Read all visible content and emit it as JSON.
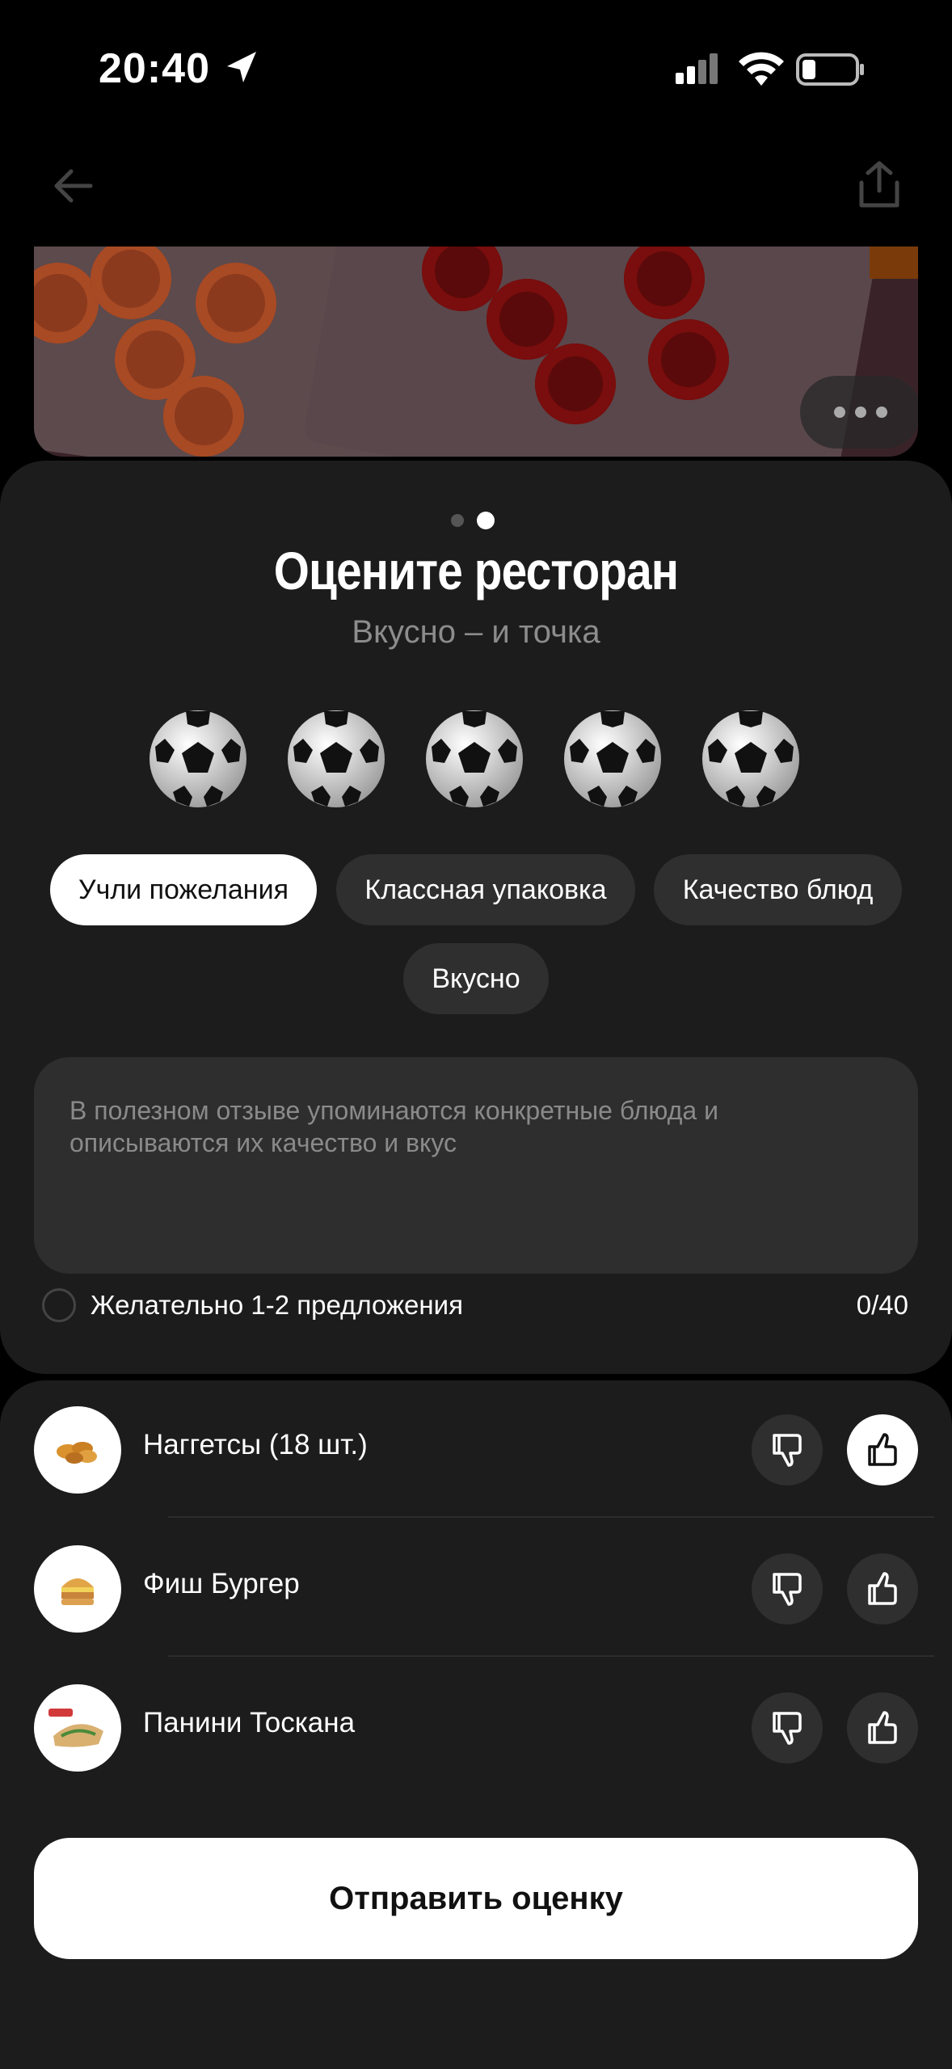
{
  "status_bar": {
    "time": "20:40"
  },
  "sheet": {
    "title": "Оцените ресторан",
    "subtitle": "Вкусно – и точка",
    "rating_icon": "soccer-ball-icon",
    "chips": [
      {
        "label": "Учли пожелания",
        "active": true
      },
      {
        "label": "Классная упаковка",
        "active": false
      },
      {
        "label": "Качество блюд",
        "active": false
      },
      {
        "label": "Вкусно",
        "active": false
      }
    ],
    "review": {
      "placeholder": "В полезном отзыве упоминаются конкретные блюда и описываются их качество и вкус",
      "hint": "Желательно 1-2 предложения",
      "counter": "0/40"
    }
  },
  "dishes": [
    {
      "name": "Наггетсы (18 шт.)",
      "liked": true
    },
    {
      "name": "Фиш Бургер",
      "liked": false
    },
    {
      "name": "Панини Тоскана",
      "liked": false
    }
  ],
  "submit_label": "Отправить оценку",
  "colors": {
    "background": "#000000",
    "sheet": "#1c1c1c",
    "chip": "#2f2f2f",
    "accent": "#ffffff"
  }
}
